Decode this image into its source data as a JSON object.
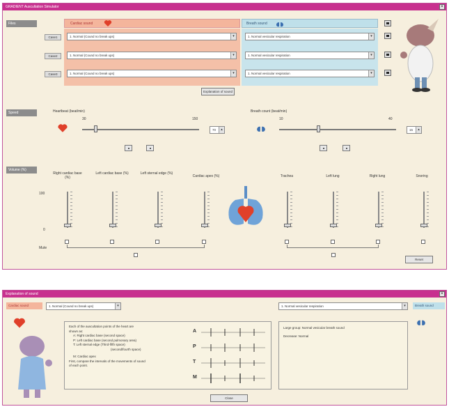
{
  "main": {
    "title": "GRADIENT Auscultation Simulator",
    "close_glyph": "×",
    "files_section": "Files",
    "cardiac_header": "Cardiac sound",
    "breath_header": "Breath sound",
    "rows": [
      {
        "tag": "Case1",
        "cardiac": "1. Normal (Cound no break ups)",
        "breath": "1. Normal vesicular respiration"
      },
      {
        "tag": "Case2",
        "cardiac": "1. Normal (Cound no break ups)",
        "breath": "1. Normal vesicular respiration"
      },
      {
        "tag": "Case3",
        "cardiac": "1. Normal (Cound no break ups)",
        "breath": "1. Normal vesicular respiration"
      }
    ],
    "explain_button": "Explanation of sound",
    "speed_section": "Speed",
    "heartbeat_label": "Heartbeat (beat/min)",
    "heartbeat_value": "70",
    "hb_min": "30",
    "hb_max": "150",
    "breath_label": "Breath count (beat/min)",
    "breath_value": "15",
    "br_min": "10",
    "br_max": "40",
    "volume_section": "Volume (%)",
    "vol_100": "100",
    "vol_0": "0",
    "mute": "Mute",
    "channels_left": [
      "Right cardiac base (%)",
      "Left cardiac base (%)",
      "Left sternal edge (%)",
      "Cardiac apex (%)"
    ],
    "channels_right": [
      "Trachea",
      "Left lung",
      "Right lung",
      "Snoring"
    ],
    "reset_button": "Reset",
    "colors": {
      "titlebar": "#c8308f",
      "cardiac": "#f4b59c",
      "breath": "#bfe0ea",
      "panel": "#f6efde"
    }
  },
  "explain": {
    "title": "Explanation of sound",
    "close_glyph": "×",
    "cardiac_tag": "Cardiac sound",
    "cardiac_select": "1. Normal (Cound no break ups)",
    "breath_select": "1. Normal vesicular respiration",
    "breath_tag": "Breath sound",
    "cardiac_text": [
      "Each of the auscultation points of the heart are",
      "shown as:",
      "A: Right cardiac base (second space)",
      "P: Left cardiac base (second pulmonary area)",
      "T: Left sternal edge (Third-fifth space)",
      "(second/fourth space)",
      "M: Cardiac apex",
      "First, compare the intervals of the movements of sound",
      "of each point."
    ],
    "wave_labels": [
      "A",
      "P",
      "T",
      "M"
    ],
    "breath_text_1": "Large group: Normal vesicular breath sound",
    "breath_text_2": "Decrease: Normal",
    "close_button": "Close"
  }
}
